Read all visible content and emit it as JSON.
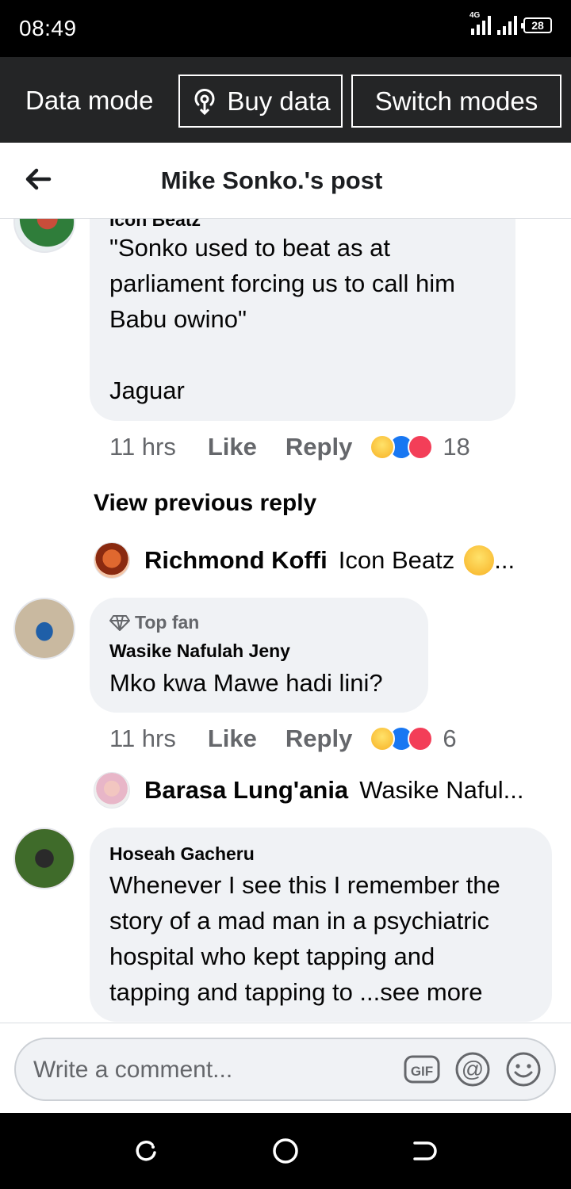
{
  "status_bar": {
    "time": "08:49",
    "network": "4G",
    "battery": "28"
  },
  "data_bar": {
    "mode_label": "Data mode",
    "buy_label": "Buy data",
    "switch_label": "Switch modes"
  },
  "header": {
    "title": "Mike Sonko.'s post"
  },
  "comments": [
    {
      "author": "Icon Beatz",
      "text": "\"Sonko used to beat as at\nparliament forcing us to call him\nBabu owino\"\n\nJaguar",
      "time": "11 hrs",
      "like": "Like",
      "reply": "Reply",
      "reaction_count": "18"
    },
    {
      "badge": "Top fan",
      "author": "Wasike Nafulah Jeny",
      "text": "Mko kwa Mawe hadi lini?",
      "time": "11 hrs",
      "like": "Like",
      "reply": "Reply",
      "reaction_count": "6"
    },
    {
      "author": "Hoseah Gacheru",
      "text": "Whenever I see this I remember the\nstory of a mad man in a psychiatric\nhospital who kept tapping and\ntapping and tapping to ...see more"
    }
  ],
  "view_previous_reply": "View previous reply",
  "replies": [
    {
      "name": "Richmond Koffi",
      "preview": "Icon Beatz",
      "ellipsis": "..."
    },
    {
      "name": "Barasa Lung'ania",
      "preview": "Wasike Naful...",
      "ellipsis": ""
    }
  ],
  "composer": {
    "placeholder": "Write a comment...",
    "gif_label": "GIF"
  },
  "icons": {
    "back": "arrow-left-icon",
    "buy": "wifi-broadcast-icon",
    "at": "at-sign-icon",
    "emoji": "smiley-icon",
    "gif": "gif-icon",
    "nav_recent": "recent-apps-icon",
    "nav_home": "home-circle-icon",
    "nav_back": "back-nav-icon"
  },
  "colors": {
    "link_blue": "#1877f2",
    "bubble_gray": "#f0f2f5",
    "meta_gray": "#65676b",
    "data_bar": "#242526"
  }
}
